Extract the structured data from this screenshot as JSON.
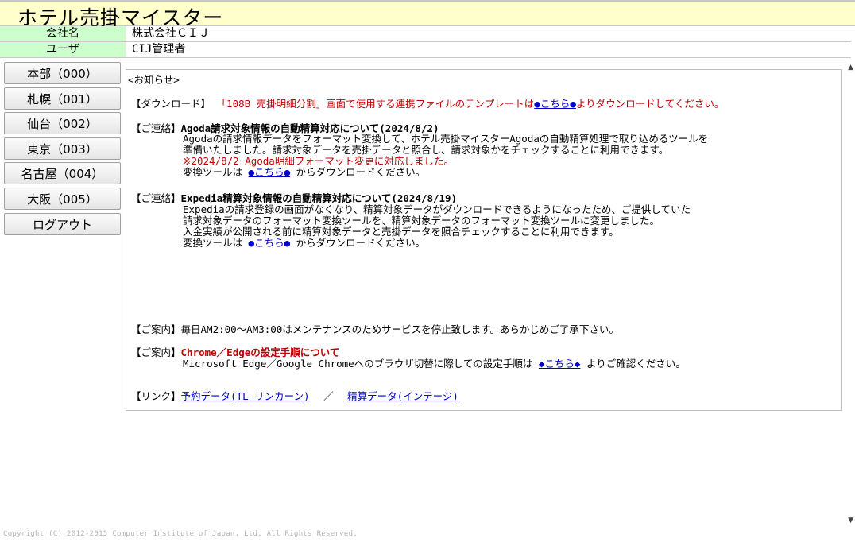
{
  "app": {
    "title": "ホテル売掛マイスター"
  },
  "info": {
    "company_label": "会社名",
    "company_value": "株式会社ＣＩＪ",
    "user_label": "ユーザ",
    "user_value": "CIJ管理者"
  },
  "menu": {
    "items": [
      "本部（000）",
      "札幌（001）",
      "仙台（002）",
      "東京（003）",
      "名古屋（004）",
      "大阪（005）"
    ],
    "logout": "ログアウト"
  },
  "notice": {
    "header": "<お知らせ>",
    "download": {
      "tag": "【ダウンロード】",
      "text_before": "「108B 売掛明細分割」画面で使用する連携ファイルのテンプレートは",
      "link": "●こちら●",
      "text_after": "よりダウンロードしてください。"
    },
    "agoda": {
      "tag": "【ご連絡】",
      "title": "Agoda請求対象情報の自動精算対応について(2024/8/2)",
      "line1": "Agodaの請求情報データをフォーマット変換して、ホテル売掛マイスターAgodaの自動精算処理で取り込めるツールを",
      "line2": "準備いたしました。請求対象データを売掛データと照合し、請求対象かをチェックすることに利用できます。",
      "line3": "※2024/8/2 Agoda明細フォーマット変更に対応しました。",
      "line4_before": "変換ツールは",
      "link": "●こちら●",
      "line4_after": "からダウンロードください。"
    },
    "expedia": {
      "tag": "【ご連絡】",
      "title": "Expedia精算対象情報の自動精算対応について(2024/8/19)",
      "line1": "Expediaの請求登録の画面がなくなり、精算対象データがダウンロードできるようになったため、ご提供していた",
      "line2": "請求対象データのフォーマット変換ツールを、精算対象データのフォーマット変換ツールに変更しました。",
      "line3": "入金実績が公開される前に精算対象データと売掛データを照合チェックすることに利用できます。",
      "line4_before": "変換ツールは",
      "link": "●こちら●",
      "line4_after": "からダウンロードください。"
    },
    "maintenance": {
      "tag": "【ご案内】",
      "text": "毎日AM2:00～AM3:00はメンテナンスのためサービスを停止致します。あらかじめご了承下さい。"
    },
    "browser": {
      "tag": "【ご案内】",
      "title": "Chrome／Edgeの設定手順について",
      "text_before": "Microsoft Edge／Google Chromeへのブラウザ切替に際しての設定手順は",
      "link": "◆こちら◆",
      "text_after": "よりご確認ください。"
    },
    "links": {
      "tag": "【リンク】",
      "link1": "予約データ(TL-リンカーン)",
      "separator": "／",
      "link2": "精算データ(インテージ)"
    }
  },
  "footer": {
    "copyright": "Copyright (C) 2012-2015 Computer Institute of Japan, Ltd. All Rights Reserved."
  },
  "colors": {
    "title_bg": "#ffffcc",
    "label_bg": "#ccffcc",
    "red": "#c00000",
    "link": "#0000cc"
  }
}
